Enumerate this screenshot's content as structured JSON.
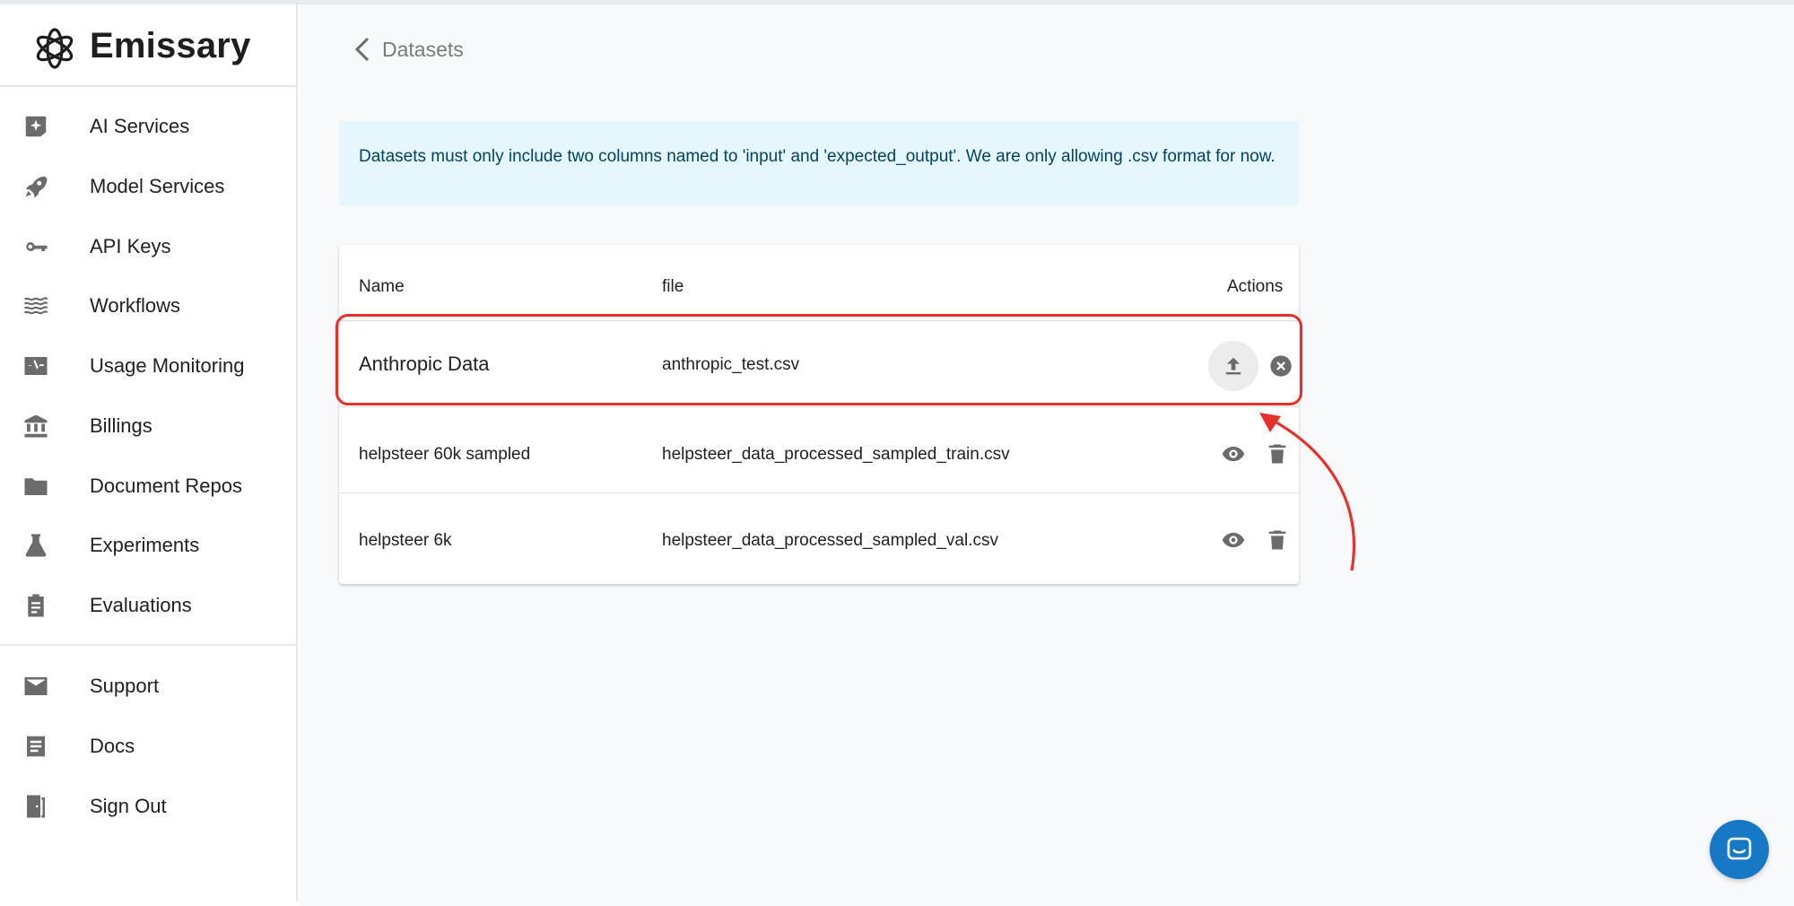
{
  "app": {
    "name": "Emissary"
  },
  "sidebar": {
    "primary": [
      {
        "label": "AI Services",
        "icon": "sparkle-icon"
      },
      {
        "label": "Model Services",
        "icon": "rocket-icon"
      },
      {
        "label": "API Keys",
        "icon": "key-icon"
      },
      {
        "label": "Workflows",
        "icon": "waves-icon"
      },
      {
        "label": "Usage Monitoring",
        "icon": "monitor-heartbeat-icon"
      },
      {
        "label": "Billings",
        "icon": "bank-icon"
      },
      {
        "label": "Document Repos",
        "icon": "folder-icon"
      },
      {
        "label": "Experiments",
        "icon": "flask-icon"
      },
      {
        "label": "Evaluations",
        "icon": "clipboard-icon"
      }
    ],
    "secondary": [
      {
        "label": "Support",
        "icon": "mail-icon"
      },
      {
        "label": "Docs",
        "icon": "document-icon"
      },
      {
        "label": "Sign Out",
        "icon": "exit-door-icon"
      }
    ]
  },
  "header": {
    "back_label": "Datasets"
  },
  "alert": {
    "text": "Datasets must only include two columns named to 'input' and 'expected_output'. We are only allowing .csv format for now."
  },
  "table": {
    "columns": [
      "Name",
      "file",
      "Actions"
    ],
    "rows": [
      {
        "name": "Anthropic Data",
        "file": "anthropic_test.csv",
        "actions": [
          "upload",
          "cancel"
        ]
      },
      {
        "name": "helpsteer 60k sampled",
        "file": "helpsteer_data_processed_sampled_train.csv",
        "actions": [
          "view",
          "delete"
        ]
      },
      {
        "name": "helpsteer 6k",
        "file": "helpsteer_data_processed_sampled_val.csv",
        "actions": [
          "view",
          "delete"
        ]
      }
    ]
  },
  "colors": {
    "accent_highlight": "#e8302a",
    "alert_bg": "#e5f6fd",
    "alert_text": "#014361",
    "chat_button": "#1779c6"
  }
}
